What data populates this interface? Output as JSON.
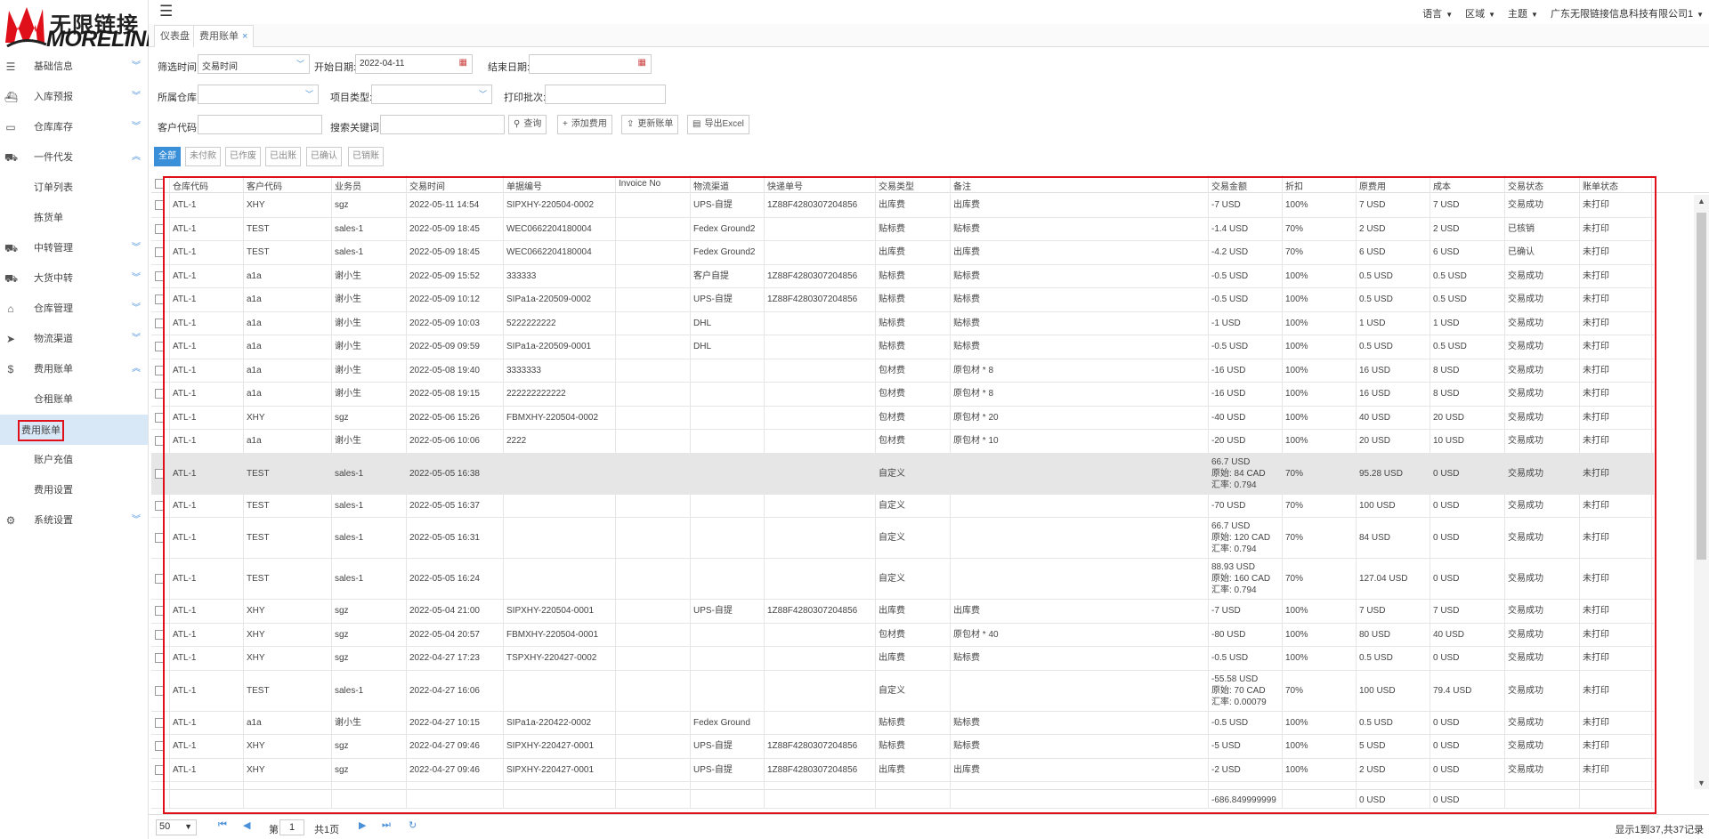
{
  "brand": {
    "cn": "无限链接",
    "en": "MORELINK",
    "color": "#e0101a"
  },
  "topbar": {
    "menu_icon": "hamburger-icon",
    "items": [
      "语言",
      "区域",
      "主题",
      "广东无限链接信息科技有限公司1"
    ]
  },
  "tabs": [
    {
      "label": "仪表盘"
    },
    {
      "label": "费用账单",
      "close": "×"
    }
  ],
  "sidebar": {
    "items": [
      {
        "label": "基础信息",
        "icon": "list-icon",
        "glyph": "☰",
        "chev": "︾"
      },
      {
        "label": "入库预报",
        "icon": "ship-icon",
        "glyph": "⛴",
        "chev": "︾"
      },
      {
        "label": "仓库库存",
        "icon": "inbox-icon",
        "glyph": "▭",
        "chev": "︾"
      },
      {
        "label": "一件代发",
        "icon": "truck-icon",
        "glyph": "⛟",
        "chev": "︽"
      },
      {
        "label": "订单列表",
        "sub": true
      },
      {
        "label": "拣货单",
        "sub": true
      },
      {
        "label": "中转管理",
        "icon": "truck-icon",
        "glyph": "⛟",
        "chev": "︾"
      },
      {
        "label": "大货中转",
        "icon": "truck-icon",
        "glyph": "⛟",
        "chev": "︾"
      },
      {
        "label": "仓库管理",
        "icon": "home-icon",
        "glyph": "⌂",
        "chev": "︾"
      },
      {
        "label": "物流渠道",
        "icon": "cursor-icon",
        "glyph": "➤",
        "chev": "︾"
      },
      {
        "label": "费用账单",
        "icon": "dollar-icon",
        "glyph": "$",
        "chev": "︽"
      },
      {
        "label": "仓租账单",
        "sub": true
      },
      {
        "label": "费用账单",
        "sub": true,
        "active": true
      },
      {
        "label": "账户充值",
        "sub": true
      },
      {
        "label": "费用设置",
        "sub": true
      },
      {
        "label": "系统设置",
        "icon": "gear-icon",
        "glyph": "⚙",
        "chev": "︾"
      }
    ]
  },
  "filters": {
    "filter_time_label": "筛选时间:",
    "filter_time_value": "交易时间",
    "start_date_label": "开始日期:",
    "start_date_value": "2022-04-11",
    "end_date_label": "结束日期:",
    "end_date_value": "",
    "warehouse_label": "所属仓库:",
    "warehouse_value": "",
    "item_type_label": "项目类型:",
    "item_type_value": "",
    "print_batch_label": "打印批次:",
    "print_batch_value": "",
    "customer_code_label": "客户代码:",
    "customer_code_value": "",
    "keyword_label": "搜索关键词:",
    "keyword_value": "",
    "search_btn": "查询",
    "add_fee_btn": "添加费用",
    "update_bill_btn": "更新账单",
    "export_btn": "导出Excel"
  },
  "status_tabs": [
    "全部",
    "未付款",
    "已作废",
    "已出账",
    "已确认",
    "已销账"
  ],
  "table": {
    "columns": [
      "仓库代码",
      "客户代码",
      "业务员",
      "交易时间",
      "单据编号",
      "Invoice No",
      "物流渠道",
      "快递单号",
      "交易类型",
      "备注",
      "交易金额",
      "折扣",
      "原费用",
      "成本",
      "交易状态",
      "账单状态"
    ],
    "rows": [
      [
        "ATL-1",
        "XHY",
        "sgz",
        "2022-05-11 14:54",
        "SIPXHY-220504-0002",
        "",
        "UPS-自提",
        "1Z88F4280307204856",
        "出库费",
        "出库费",
        "-7 USD",
        "100%",
        "7 USD",
        "7 USD",
        "交易成功",
        "未打印"
      ],
      [
        "ATL-1",
        "TEST",
        "sales-1",
        "2022-05-09 18:45",
        "WEC0662204180004",
        "",
        "Fedex Ground2",
        "",
        "贴标费",
        "贴标费",
        "-1.4 USD",
        "70%",
        "2 USD",
        "2 USD",
        "已核销",
        "未打印"
      ],
      [
        "ATL-1",
        "TEST",
        "sales-1",
        "2022-05-09 18:45",
        "WEC0662204180004",
        "",
        "Fedex Ground2",
        "",
        "出库费",
        "出库费",
        "-4.2 USD",
        "70%",
        "6 USD",
        "6 USD",
        "已确认",
        "未打印"
      ],
      [
        "ATL-1",
        "a1a",
        "谢小生",
        "2022-05-09 15:52",
        "333333",
        "",
        "客户自提",
        "1Z88F4280307204856",
        "贴标费",
        "贴标费",
        "-0.5 USD",
        "100%",
        "0.5 USD",
        "0.5 USD",
        "交易成功",
        "未打印"
      ],
      [
        "ATL-1",
        "a1a",
        "谢小生",
        "2022-05-09 10:12",
        "SIPa1a-220509-0002",
        "",
        "UPS-自提",
        "1Z88F4280307204856",
        "贴标费",
        "贴标费",
        "-0.5 USD",
        "100%",
        "0.5 USD",
        "0.5 USD",
        "交易成功",
        "未打印"
      ],
      [
        "ATL-1",
        "a1a",
        "谢小生",
        "2022-05-09 10:03",
        "5222222222",
        "",
        "DHL",
        "",
        "贴标费",
        "贴标费",
        "-1 USD",
        "100%",
        "1 USD",
        "1 USD",
        "交易成功",
        "未打印"
      ],
      [
        "ATL-1",
        "a1a",
        "谢小生",
        "2022-05-09 09:59",
        "SIPa1a-220509-0001",
        "",
        "DHL",
        "",
        "贴标费",
        "贴标费",
        "-0.5 USD",
        "100%",
        "0.5 USD",
        "0.5 USD",
        "交易成功",
        "未打印"
      ],
      [
        "ATL-1",
        "a1a",
        "谢小生",
        "2022-05-08 19:40",
        "3333333",
        "",
        "",
        "",
        "包材费",
        "原包材 * 8",
        "-16 USD",
        "100%",
        "16 USD",
        "8 USD",
        "交易成功",
        "未打印"
      ],
      [
        "ATL-1",
        "a1a",
        "谢小生",
        "2022-05-08 19:15",
        "222222222222",
        "",
        "",
        "",
        "包材费",
        "原包材 * 8",
        "-16 USD",
        "100%",
        "16 USD",
        "8 USD",
        "交易成功",
        "未打印"
      ],
      [
        "ATL-1",
        "XHY",
        "sgz",
        "2022-05-06 15:26",
        "FBMXHY-220504-0002",
        "",
        "",
        "",
        "包材费",
        "原包材 * 20",
        "-40 USD",
        "100%",
        "40 USD",
        "20 USD",
        "交易成功",
        "未打印"
      ],
      [
        "ATL-1",
        "a1a",
        "谢小生",
        "2022-05-06 10:06",
        "2222",
        "",
        "",
        "",
        "包材费",
        "原包材 * 10",
        "-20 USD",
        "100%",
        "20 USD",
        "10 USD",
        "交易成功",
        "未打印"
      ],
      [
        "ATL-1",
        "TEST",
        "sales-1",
        "2022-05-05 16:38",
        "",
        "",
        "",
        "",
        "自定义",
        "",
        "66.7 USD\n原始: 84 CAD\n汇率: 0.794",
        "70%",
        "95.28 USD",
        "0 USD",
        "交易成功",
        "未打印"
      ],
      [
        "ATL-1",
        "TEST",
        "sales-1",
        "2022-05-05 16:37",
        "",
        "",
        "",
        "",
        "自定义",
        "",
        "-70 USD",
        "70%",
        "100 USD",
        "0 USD",
        "交易成功",
        "未打印"
      ],
      [
        "ATL-1",
        "TEST",
        "sales-1",
        "2022-05-05 16:31",
        "",
        "",
        "",
        "",
        "自定义",
        "",
        "66.7 USD\n原始: 120 CAD\n汇率: 0.794",
        "70%",
        "84 USD",
        "0 USD",
        "交易成功",
        "未打印"
      ],
      [
        "ATL-1",
        "TEST",
        "sales-1",
        "2022-05-05 16:24",
        "",
        "",
        "",
        "",
        "自定义",
        "",
        "88.93 USD\n原始: 160 CAD\n汇率: 0.794",
        "70%",
        "127.04 USD",
        "0 USD",
        "交易成功",
        "未打印"
      ],
      [
        "ATL-1",
        "XHY",
        "sgz",
        "2022-05-04 21:00",
        "SIPXHY-220504-0001",
        "",
        "UPS-自提",
        "1Z88F4280307204856",
        "出库费",
        "出库费",
        "-7 USD",
        "100%",
        "7 USD",
        "7 USD",
        "交易成功",
        "未打印"
      ],
      [
        "ATL-1",
        "XHY",
        "sgz",
        "2022-05-04 20:57",
        "FBMXHY-220504-0001",
        "",
        "",
        "",
        "包材费",
        "原包材 * 40",
        "-80 USD",
        "100%",
        "80 USD",
        "40 USD",
        "交易成功",
        "未打印"
      ],
      [
        "ATL-1",
        "XHY",
        "sgz",
        "2022-04-27 17:23",
        "TSPXHY-220427-0002",
        "",
        "",
        "",
        "出库费",
        "贴标费",
        "-0.5 USD",
        "100%",
        "0.5 USD",
        "0 USD",
        "交易成功",
        "未打印"
      ],
      [
        "ATL-1",
        "TEST",
        "sales-1",
        "2022-04-27 16:06",
        "",
        "",
        "",
        "",
        "自定义",
        "",
        "-55.58 USD\n原始: 70 CAD\n汇率: 0.00079",
        "70%",
        "100 USD",
        "79.4 USD",
        "交易成功",
        "未打印"
      ],
      [
        "ATL-1",
        "a1a",
        "谢小生",
        "2022-04-27 10:15",
        "SIPa1a-220422-0002",
        "",
        "Fedex Ground",
        "",
        "贴标费",
        "贴标费",
        "-0.5 USD",
        "100%",
        "0.5 USD",
        "0 USD",
        "交易成功",
        "未打印"
      ],
      [
        "ATL-1",
        "XHY",
        "sgz",
        "2022-04-27 09:46",
        "SIPXHY-220427-0001",
        "",
        "UPS-自提",
        "1Z88F4280307204856",
        "贴标费",
        "贴标费",
        "-5 USD",
        "100%",
        "5 USD",
        "0 USD",
        "交易成功",
        "未打印"
      ],
      [
        "ATL-1",
        "XHY",
        "sgz",
        "2022-04-27 09:46",
        "SIPXHY-220427-0001",
        "",
        "UPS-自提",
        "1Z88F4280307204856",
        "出库费",
        "出库费",
        "-2 USD",
        "100%",
        "2 USD",
        "0 USD",
        "交易成功",
        "未打印"
      ]
    ],
    "footer": {
      "amount": "-686.849999999",
      "orig": "0 USD",
      "cost": "0 USD"
    }
  },
  "pager": {
    "page_size": "50",
    "page_label": "第",
    "page": "1",
    "total": "共1页",
    "info": "显示1到37,共37记录"
  }
}
